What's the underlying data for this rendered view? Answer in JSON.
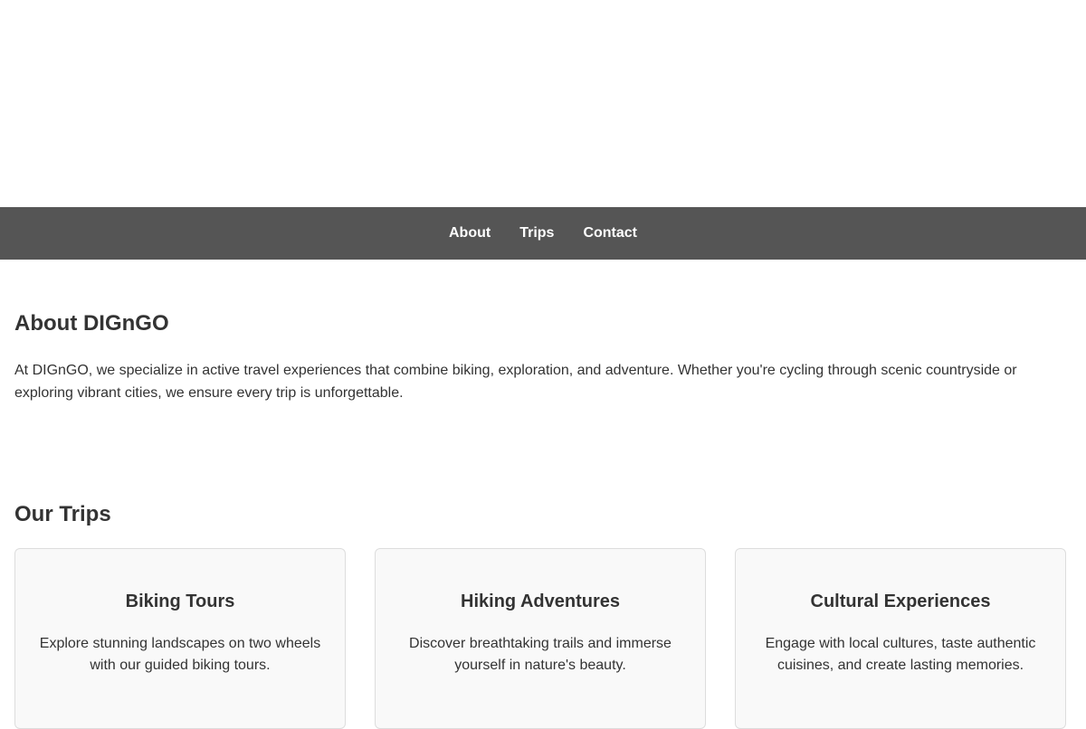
{
  "nav": {
    "items": [
      {
        "label": "About"
      },
      {
        "label": "Trips"
      },
      {
        "label": "Contact"
      }
    ]
  },
  "about": {
    "title": "About DIGnGO",
    "text": "At DIGnGO, we specialize in active travel experiences that combine biking, exploration, and adventure. Whether you're cycling through scenic countryside or exploring vibrant cities, we ensure every trip is unforgettable."
  },
  "trips": {
    "title": "Our Trips",
    "cards": [
      {
        "title": "Biking Tours",
        "desc": "Explore stunning landscapes on two wheels with our guided biking tours."
      },
      {
        "title": "Hiking Adventures",
        "desc": "Discover breathtaking trails and immerse yourself in nature's beauty."
      },
      {
        "title": "Cultural Experiences",
        "desc": "Engage with local cultures, taste authentic cuisines, and create lasting memories."
      }
    ]
  },
  "colors": {
    "navbar_bg": "#555555",
    "card_bg": "#f9f9f9",
    "text": "#333333"
  }
}
